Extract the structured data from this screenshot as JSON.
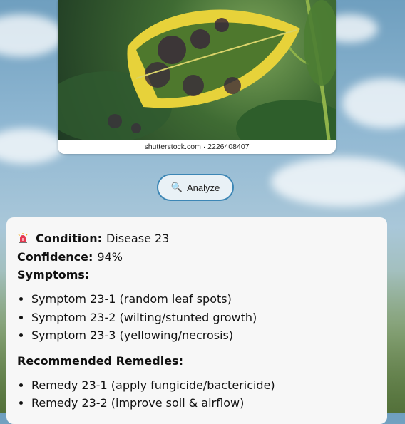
{
  "image": {
    "credit": "shutterstock.com · 2226408407"
  },
  "analyze_button": {
    "label": "Analyze",
    "icon": "magnifier-icon"
  },
  "result": {
    "condition_label": "Condition:",
    "condition_value": "Disease 23",
    "confidence_label": "Confidence:",
    "confidence_value": "94%",
    "symptoms_label": "Symptoms:",
    "symptoms": [
      "Symptom 23-1 (random leaf spots)",
      "Symptom 23-2 (wilting/stunted growth)",
      "Symptom 23-3 (yellowing/necrosis)"
    ],
    "remedies_label": "Recommended Remedies:",
    "remedies": [
      "Remedy 23-1 (apply fungicide/bactericide)",
      "Remedy 23-2 (improve soil & airflow)"
    ]
  },
  "colors": {
    "button_border": "#3c86b5",
    "card_bg": "#f7f7f7"
  }
}
